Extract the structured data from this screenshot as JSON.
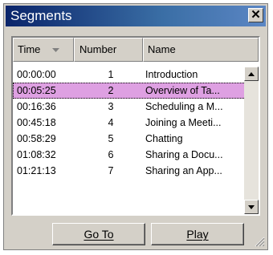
{
  "window": {
    "title": "Segments",
    "close_glyph": "✕"
  },
  "list": {
    "columns": [
      {
        "label": "Time",
        "sort_icon": "sort-descending-icon"
      },
      {
        "label": "Number"
      },
      {
        "label": "Name"
      }
    ],
    "rows": [
      {
        "time": "00:00:00",
        "number": "1",
        "name": "Introduction",
        "selected": false
      },
      {
        "time": "00:05:25",
        "number": "2",
        "name": "Overview of Ta...",
        "selected": true
      },
      {
        "time": "00:16:36",
        "number": "3",
        "name": "Scheduling a M...",
        "selected": false
      },
      {
        "time": "00:45:18",
        "number": "4",
        "name": "Joining a Meeti...",
        "selected": false
      },
      {
        "time": "00:58:29",
        "number": "5",
        "name": "Chatting",
        "selected": false
      },
      {
        "time": "01:08:32",
        "number": "6",
        "name": "Sharing a Docu...",
        "selected": false
      },
      {
        "time": "01:21:13",
        "number": "7",
        "name": "Sharing an App...",
        "selected": false
      }
    ],
    "selected_color": "#dea0e2"
  },
  "buttons": {
    "goto_label": "Go To",
    "play_label": "Play"
  },
  "colors": {
    "title_bar": "#0a246a",
    "face": "#d4d0c8"
  }
}
